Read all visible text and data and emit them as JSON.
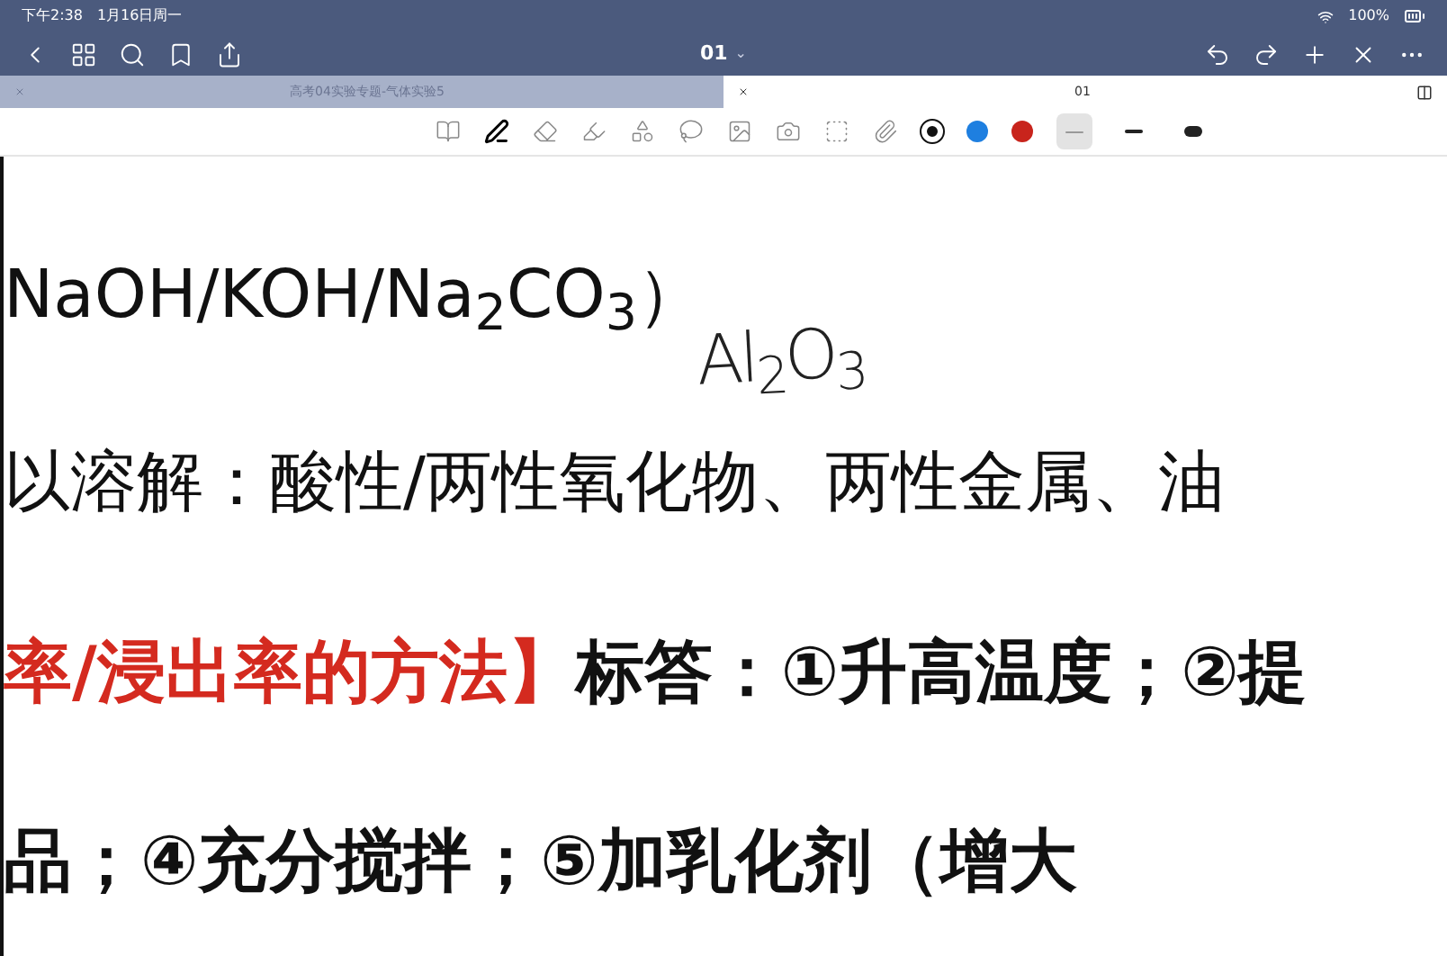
{
  "status_bar": {
    "time": "下午2:38",
    "date": "1月16日周一",
    "battery": "100%"
  },
  "nav": {
    "title": "01",
    "caret": "⌄"
  },
  "tabs": [
    {
      "label": "高考04实验专题-气体实验5",
      "selected": false
    },
    {
      "label": "01",
      "selected": true
    }
  ],
  "tools": [
    {
      "selected": false
    },
    {
      "selected": true
    },
    {
      "selected": false
    },
    {
      "selected": false
    },
    {
      "selected": false
    },
    {
      "selected": false
    },
    {
      "selected": false
    },
    {
      "selected": false
    },
    {
      "selected": false
    },
    {
      "selected": false
    }
  ],
  "pen_colors": [
    {
      "color": "#111111",
      "selected": true
    },
    {
      "color": "#1e7fe0",
      "selected": false
    },
    {
      "color": "#c8241c",
      "selected": false
    }
  ],
  "stroke_widths": [
    {
      "selected": true
    },
    {
      "selected": false
    },
    {
      "selected": false
    }
  ],
  "page": {
    "lines": [
      {
        "kind": "plain",
        "text": "NaOH/KOH/Na$_{2}$CO$_{3}$）"
      },
      {
        "kind": "plain",
        "text": "以溶解：酸性/两性氧化物、两性金属、油"
      },
      {
        "kind": "mixed",
        "segments": [
          {
            "text": "率/浸出率的方法】",
            "color": "#d42a1f"
          },
          {
            "text": "标答：①升高温度；②提",
            "color": "#111111"
          }
        ]
      },
      {
        "kind": "mixed",
        "segments": [
          {
            "text": "品；④充分搅拌；⑤加乳化剂（增大",
            "color": "#111111"
          }
        ]
      }
    ],
    "handwriting": "Al$_{2}$O$_{3}$"
  }
}
